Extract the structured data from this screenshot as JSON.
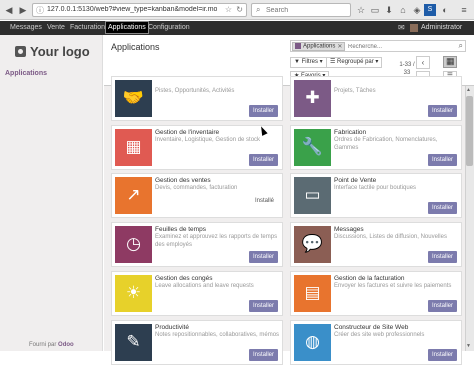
{
  "browser": {
    "url": "127.0.0.1:5130/web?#view_type=kanban&model=ir.module.mo",
    "search_placeholder": "Search"
  },
  "topbar": {
    "menus": [
      "Messages",
      "Vente",
      "Facturation",
      "Applications",
      "Configuration"
    ],
    "active_menu": "Applications",
    "user": "Administrator"
  },
  "sidebar": {
    "logo_text": "Your logo",
    "section": "Applications",
    "powered_by": "Fourni par",
    "powered_brand": "Odoo"
  },
  "control_panel": {
    "title": "Applications",
    "facet_label": "Applications",
    "search_placeholder": "Recherche...",
    "filters_label": "Filtres",
    "groupby_label": "Regroupé par",
    "favorites_label": "Favoris",
    "pager": "1-33 / 33"
  },
  "colors": {
    "install_button": "#7c7bad",
    "topbar": "#2e2e2e",
    "accent": "#7c5a86"
  },
  "cards": [
    {
      "name": "",
      "desc": "Pistes, Opportunités, Activités",
      "button": "Installer",
      "color": "#2d3e50",
      "icon": "handshake-icon"
    },
    {
      "name": "",
      "desc": "Projets, Tâches",
      "button": "Installer",
      "color": "#7c5a86",
      "icon": "puzzle-icon"
    },
    {
      "name": "Gestion de l'inventaire",
      "desc": "Inventaire, Logistique, Gestion de stock",
      "button": "Installer",
      "color": "#e05a52",
      "icon": "warehouse-icon"
    },
    {
      "name": "Fabrication",
      "desc": "Ordres de Fabrication, Nomenclatures, Gammes",
      "button": "Installer",
      "color": "#3aa14a",
      "icon": "wrench-icon"
    },
    {
      "name": "Gestion des ventes",
      "desc": "Devis, commandes, facturation",
      "button": "",
      "status": "Installé",
      "color": "#e8742e",
      "icon": "chart-up-icon"
    },
    {
      "name": "Point de Vente",
      "desc": "Interface tactile pour boutiques",
      "button": "Installer",
      "color": "#5b6b73",
      "icon": "monitor-icon"
    },
    {
      "name": "Feuilles de temps",
      "desc": "Examinez et approuvez les rapports de temps des employés",
      "button": "Installer",
      "color": "#8e3a63",
      "icon": "clock-icon"
    },
    {
      "name": "Messages",
      "desc": "Discussions, Listes de diffusion, Nouvelles",
      "button": "Installer",
      "color": "#8b5e54",
      "icon": "chat-icon"
    },
    {
      "name": "Gestion des congés",
      "desc": "Leave allocations and leave requests",
      "button": "Installer",
      "color": "#e7d12a",
      "icon": "sun-icon"
    },
    {
      "name": "Gestion de la facturation",
      "desc": "Envoyer les factures et suivre les paiements",
      "button": "Installer",
      "color": "#e8742e",
      "icon": "invoice-icon"
    },
    {
      "name": "Productivité",
      "desc": "Notes repositionnables, collaboratives, mémos",
      "button": "Installer",
      "color": "#2d3e50",
      "icon": "note-icon"
    },
    {
      "name": "Constructeur de Site Web",
      "desc": "Créer des site web professionnels",
      "button": "Installer",
      "color": "#3a8fc9",
      "icon": "globe-icon"
    }
  ]
}
